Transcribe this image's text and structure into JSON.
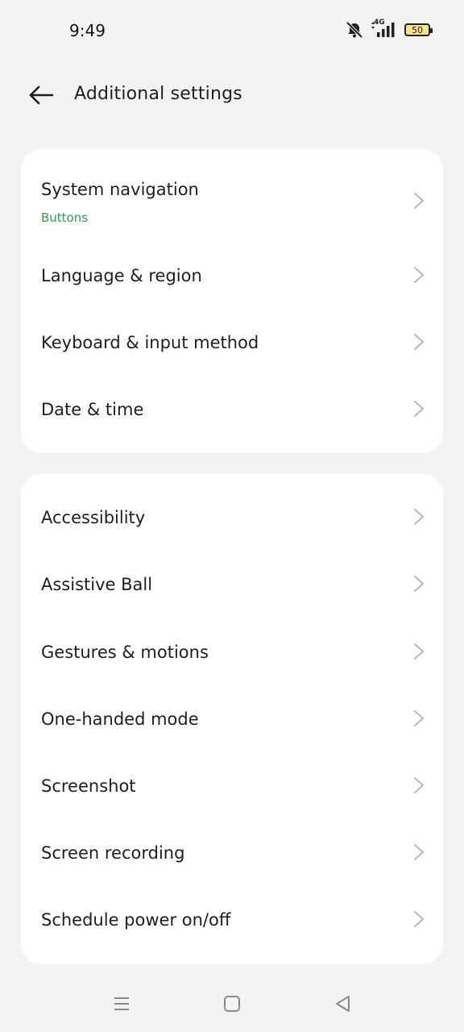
{
  "status_bar": {
    "time": "9:49",
    "network": "4G",
    "battery": "50",
    "icons": [
      "mute-icon",
      "signal-icon",
      "battery-icon"
    ]
  },
  "header": {
    "title": "Additional settings",
    "back_icon": "back-arrow-icon"
  },
  "groups": [
    {
      "items": [
        {
          "label": "System navigation",
          "sublabel": "Buttons"
        },
        {
          "label": "Language & region"
        },
        {
          "label": "Keyboard & input method"
        },
        {
          "label": "Date & time"
        }
      ]
    },
    {
      "items": [
        {
          "label": "Accessibility"
        },
        {
          "label": "Assistive Ball"
        },
        {
          "label": "Gestures & motions"
        },
        {
          "label": "One-handed mode"
        },
        {
          "label": "Screenshot"
        },
        {
          "label": "Screen recording"
        },
        {
          "label": "Schedule power on/off"
        }
      ]
    }
  ],
  "nav_bar": {
    "icons": [
      "menu-icon",
      "home-icon",
      "back-icon"
    ]
  },
  "colors": {
    "background": "#f3f3f3",
    "card": "#ffffff",
    "accent_sublabel": "#2e9e4e",
    "chevron": "#b8b8b8",
    "battery_fill": "#f5e28a"
  }
}
